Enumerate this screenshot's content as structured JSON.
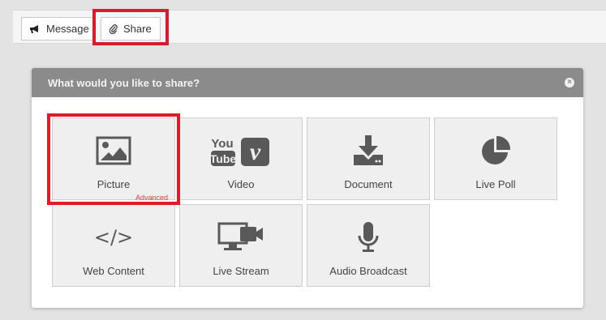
{
  "toolbar": {
    "message_label": "Message",
    "share_label": "Share"
  },
  "modal": {
    "title": "What would you like to share?",
    "close_glyph": "×"
  },
  "tiles": [
    {
      "label": "Picture",
      "icon": "picture-icon"
    },
    {
      "label": "Video",
      "icon": "youtube-vimeo-icon",
      "youtube_top": "You",
      "youtube_bottom": "Tube",
      "vimeo_glyph": "v"
    },
    {
      "label": "Document",
      "icon": "download-icon"
    },
    {
      "label": "Live Poll",
      "icon": "pie-chart-icon"
    },
    {
      "label": "Web Content",
      "icon": "code-icon",
      "badge": "Advanced",
      "code_glyph": "</>"
    },
    {
      "label": "Live Stream",
      "icon": "screen-camera-icon"
    },
    {
      "label": "Audio Broadcast",
      "icon": "microphone-icon"
    }
  ],
  "colors": {
    "highlight": "#dd1c2a",
    "header": "#8b8b8b",
    "icon": "#595959",
    "badge": "#e04040"
  }
}
